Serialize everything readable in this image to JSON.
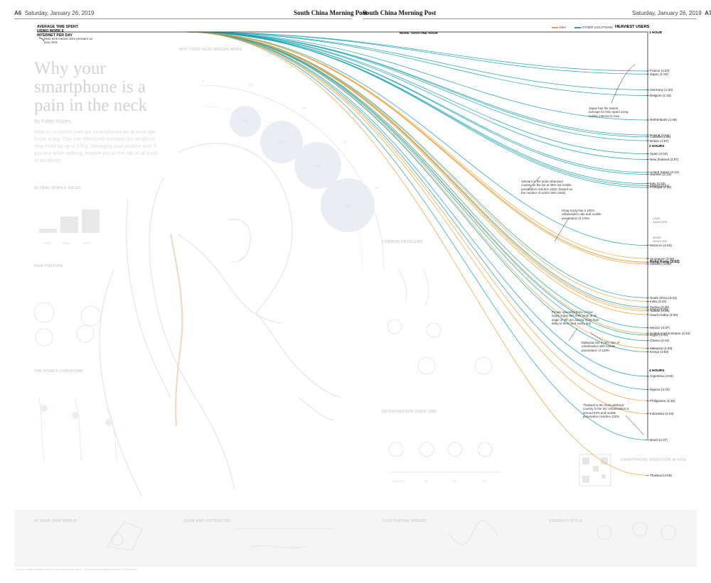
{
  "header": {
    "left_page": "A6",
    "left_date": "Saturday, January 26, 2019",
    "left_paper": "South China Morning Post",
    "right_paper": "South China Morning Post",
    "right_date": "Saturday, January 26, 2019",
    "right_page": "A7"
  },
  "story": {
    "title": "Why your smartphone is a pain in the neck",
    "byline": "By Pablo Robles",
    "intro": "Most of us hunch over our smartphones for at least two hours a day. This can effectively increase the weight of your head by up to 27kg, damaging your posture and, if you text while walking, expose you to the risk of all kinds of accidents",
    "sections": [
      "WHY YOUR HEAD WEIGHS MORE",
      "GLOBAL MOBILE SALES",
      "PAIN POSTURE",
      "THE SPINE'S CURVATURE",
      "COMMON PROBLEMS",
      "DETERIORATION OVER TIME",
      "SMARTPHONE ADDICTION IN ASIA"
    ],
    "footer_sections": [
      "IN YOUR OWN WORLD",
      "SLOW AND DISTRACTED",
      "FLUCTUATING SPEEDS",
      "SIDEWAYS STYLE"
    ],
    "head_weights": [
      "12kg",
      "18kg",
      "22kg",
      "27kg"
    ],
    "angles": [
      "0°",
      "15°",
      "30°",
      "45°",
      "60°"
    ],
    "sales_years": [
      "2007",
      "2012",
      "2017"
    ],
    "ages": [
      "25 years",
      "40",
      "50",
      "60",
      "80"
    ]
  },
  "chart": {
    "axis_title": "AVERAGE TIME SPENT USING MOBILE INTERNET PER DAY",
    "neck_note": "More time means more pressure on your neck",
    "more_than_one_hour": "MORE THAN ONE HOUR",
    "heaviest_users": "HEAVIEST USERS",
    "legend": [
      {
        "label": "ASIA",
        "color": "#f0a33a"
      },
      {
        "label": "OTHER LOCATIONS",
        "color": "#1aa3b3"
      }
    ],
    "hour_marks": [
      {
        "label": "1 HOUR",
        "value": 1.0
      },
      {
        "label": "2 HOURS",
        "value": 2.0
      },
      {
        "label": "4 HOURS",
        "value": 4.0
      }
    ],
    "addiction_labels": [
      "LESS ADDICTED",
      "MORE ADDICTED"
    ],
    "countries": [
      {
        "name": "France",
        "value": "(1:20)",
        "region": "other",
        "t": 1.333
      },
      {
        "name": "Japan",
        "value": "(1:20)",
        "region": "other",
        "t": 1.36
      },
      {
        "name": "Germany",
        "value": "(1:30)",
        "region": "other",
        "t": 1.5
      },
      {
        "name": "Belgium",
        "value": "(1:33)",
        "region": "other",
        "t": 1.55
      },
      {
        "name": "Netherlands",
        "value": "(1:46)",
        "region": "other",
        "t": 1.767
      },
      {
        "name": "Poland",
        "value": "(1:54)",
        "region": "other",
        "t": 1.9
      },
      {
        "name": "Canada",
        "value": "(1:55)",
        "region": "other",
        "t": 1.917
      },
      {
        "name": "Britain",
        "value": "(1:57)",
        "region": "other",
        "t": 1.95
      },
      {
        "name": "Spain",
        "value": "(2:04)",
        "region": "other",
        "t": 2.067
      },
      {
        "name": "New Zealand",
        "value": "(2:07)",
        "region": "other",
        "t": 2.117
      },
      {
        "name": "United States",
        "value": "(2:14)",
        "region": "other",
        "t": 2.233
      },
      {
        "name": "Sweden",
        "value": "(2:15)",
        "region": "other",
        "t": 2.25
      },
      {
        "name": "Italy",
        "value": "(2:20)",
        "region": "other",
        "t": 2.333
      },
      {
        "name": "Ireland",
        "value": "(2:21)",
        "region": "other",
        "t": 2.35
      },
      {
        "name": "Portugal",
        "value": "(2:22)",
        "region": "other",
        "t": 2.367
      },
      {
        "name": "Morocco",
        "value": "(2:53)",
        "region": "other",
        "t": 2.883
      },
      {
        "name": "Singapore",
        "value": "(3:00)",
        "region": "asia",
        "t": 3.0
      },
      {
        "name": "Hong Kong",
        "value": "(3:02)",
        "region": "asia",
        "t": 3.033,
        "highlight": true
      },
      {
        "name": "Vietnam",
        "value": "(3:02)",
        "region": "asia",
        "t": 3.05
      },
      {
        "name": "South Africa",
        "value": "(3:21)",
        "region": "other",
        "t": 3.35
      },
      {
        "name": "India",
        "value": "(3:23)",
        "region": "asia",
        "t": 3.383
      },
      {
        "name": "Turkey",
        "value": "(3:26)",
        "region": "other",
        "t": 3.433
      },
      {
        "name": "China",
        "value": "(3:26)",
        "region": "asia",
        "t": 3.45
      },
      {
        "name": "Taiwan",
        "value": "(3:28)",
        "region": "asia",
        "t": 3.467
      },
      {
        "name": "Saudi Arabia",
        "value": "(3:30)",
        "region": "asia",
        "t": 3.5
      },
      {
        "name": "Mexico",
        "value": "(3:37)",
        "region": "other",
        "t": 3.617
      },
      {
        "name": "United Arab Emirates",
        "value": "(3:40)",
        "region": "asia",
        "t": 3.667
      },
      {
        "name": "Egypt",
        "value": "(3:41)",
        "region": "other",
        "t": 3.683
      },
      {
        "name": "Ghana",
        "value": "(3:44)",
        "region": "other",
        "t": 3.733
      },
      {
        "name": "Malaysia",
        "value": "(3:48)",
        "region": "asia",
        "t": 3.8
      },
      {
        "name": "Kenya",
        "value": "(3:50)",
        "region": "other",
        "t": 3.833
      },
      {
        "name": "Argentina",
        "value": "(4:03)",
        "region": "other",
        "t": 4.05
      },
      {
        "name": "Nigeria",
        "value": "(4:10)",
        "region": "other",
        "t": 4.167
      },
      {
        "name": "Philippines",
        "value": "(4:16)",
        "region": "asia",
        "t": 4.267
      },
      {
        "name": "Indonesia",
        "value": "(4:23)",
        "region": "asia",
        "t": 4.383
      },
      {
        "name": "Brazil",
        "value": "(4:37)",
        "region": "other",
        "t": 4.617
      },
      {
        "name": "Thailand",
        "value": "(4:56)",
        "region": "asia",
        "t": 4.933
      }
    ],
    "annotations": [
      {
        "id": "japan",
        "text": "Japan has the lowest average for time spent using mobile internet in Asia"
      },
      {
        "id": "vietnam",
        "text": "Vietnam is the least urbanised country on the list at 35% but mobile penetration reaches 153% (based on the number of active SIM cards)"
      },
      {
        "id": "hongkong",
        "text": "Hong Kong has a 100% urbanisation rate and mobile penetration of 170%"
      },
      {
        "id": "people",
        "text": "People spending three or four hours a day with their neck at an angle of 45° are adding more than 60kg to their neck every day"
      },
      {
        "id": "malaysia",
        "text": "Malaysia has a 76% rate of urbanisation with mobile penetration of 133%"
      },
      {
        "id": "thailand",
        "text": "Thailand is the most addicted country in the list. Urbanisation is around 53% and mobile penetration reaches 133%"
      }
    ]
  },
  "footer": {
    "credit": "Sources: Mobile Addiction research, Harvard Medical School, Surgical Technology International, Pew Research"
  },
  "colors": {
    "asia": "#f0a33a",
    "other": "#1aa3b3",
    "faded": "#d6d6d6"
  }
}
